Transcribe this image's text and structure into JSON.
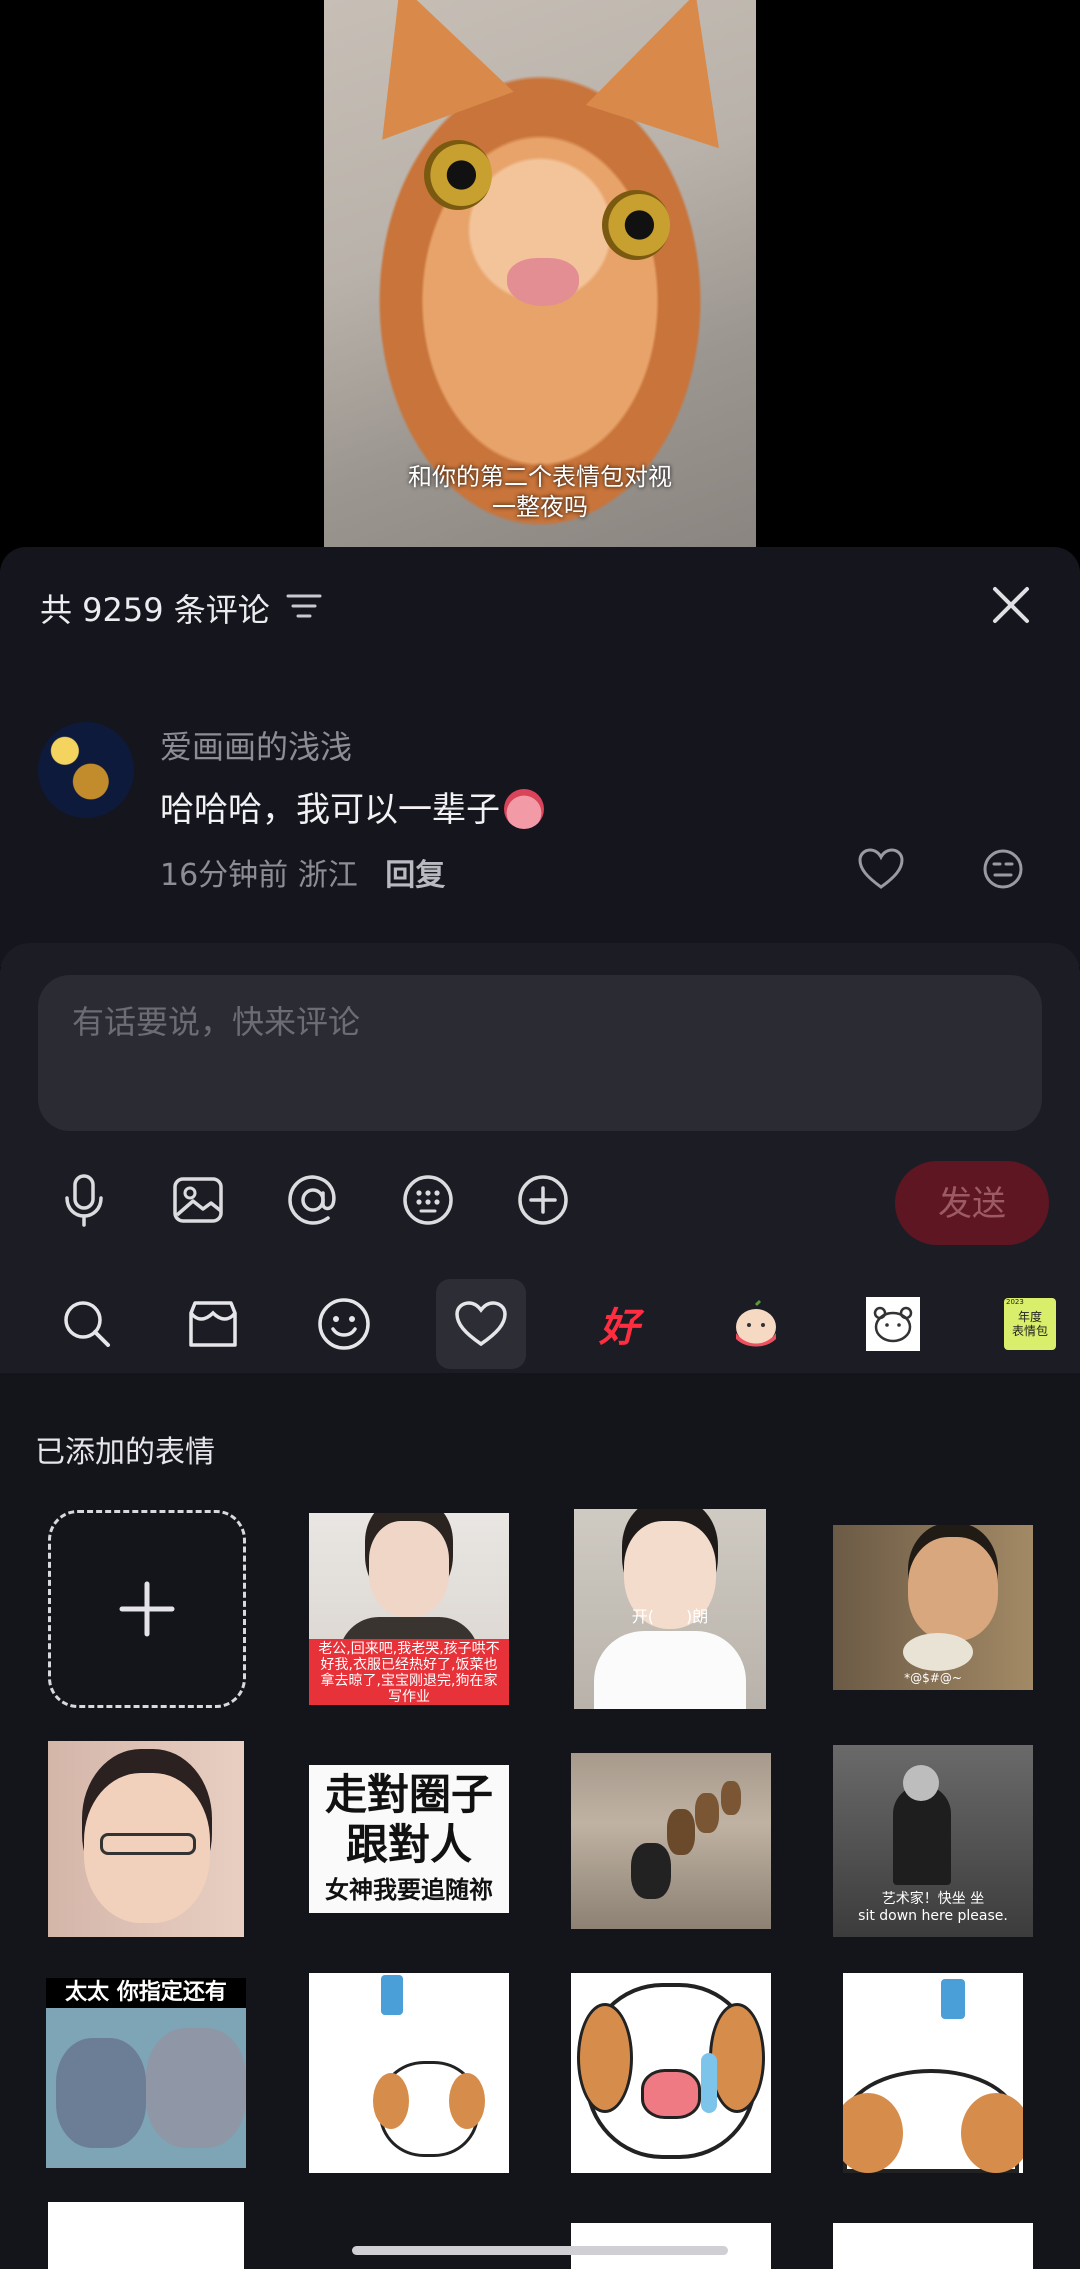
{
  "video": {
    "caption": "和你的第二个表情包对视\n一整夜吗"
  },
  "comments": {
    "count_label": "共 9259 条评论",
    "items": [
      {
        "author": "爱画画的浅浅",
        "text": "哈哈哈，我可以一辈子",
        "time": "16分钟前",
        "location": "浙江",
        "reply_label": "回复"
      }
    ]
  },
  "input": {
    "placeholder": "有话要说，快来评论",
    "send_label": "发送"
  },
  "toolbar": {
    "tools": [
      "microphone-icon",
      "image-icon",
      "at-icon",
      "keyboard-icon",
      "plus-circle-icon"
    ]
  },
  "sticker_tabs": [
    "search-icon",
    "box-icon",
    "smiley-icon",
    "heart-icon",
    "hao-sticker",
    "peach-sticker",
    "bear-sticker",
    "annual-sticker"
  ],
  "sticker_tab_texts": {
    "hao": "好",
    "annual": "年度\n表情包",
    "annual_year": "2023"
  },
  "stickers": {
    "heading": "已添加的表情",
    "s2_caption": "老公,回来吧,我老哭,孩子哄不好我,衣服已经热好了,饭菜也拿去晾了,宝宝刚退完,狗在家写作业",
    "s3_caption": "开(　　)朗",
    "s4_caption": "*@$#@~",
    "s6_line1": "走對圈子",
    "s6_line2": "跟對人",
    "s6_line3": "女神我要追随祢",
    "s8_caption": "艺术家！快坐 坐\nsit down here please.",
    "s9_caption": "太太 你指定还有"
  },
  "colors": {
    "sheet_bg": "#15151d",
    "input_panel_bg": "#1c1c24",
    "send_button_bg": "#5e1623",
    "accent_red": "#e52a3a"
  }
}
